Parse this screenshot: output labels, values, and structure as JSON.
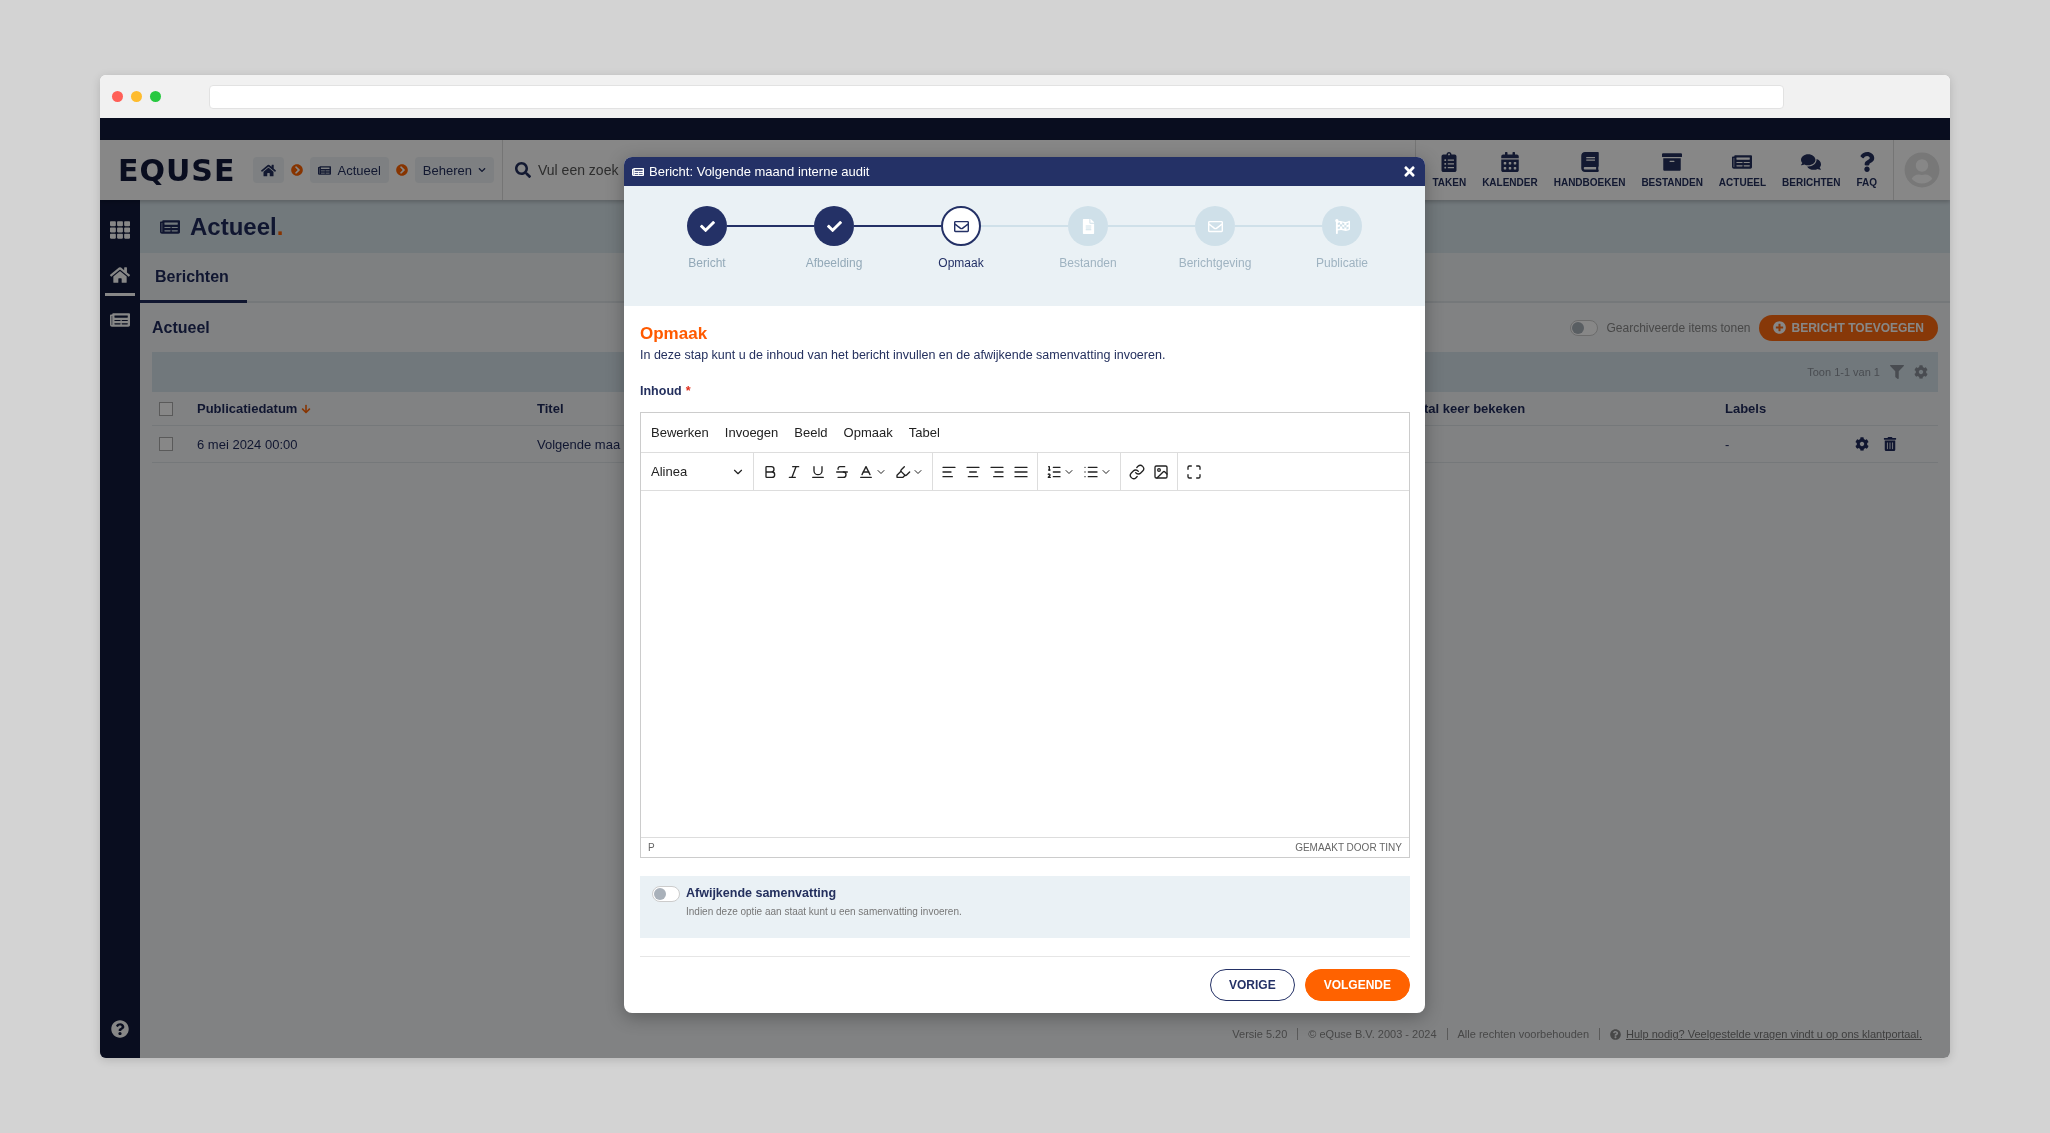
{
  "header": {
    "logo": "EQUSE",
    "breadcrumb": [
      {
        "kind": "home"
      },
      {
        "kind": "link",
        "label": "Actueel"
      },
      {
        "kind": "dropdown",
        "label": "Beheren"
      }
    ],
    "search": {
      "placeholder": "Vul een zoek"
    },
    "nav": [
      {
        "kind": "tasks",
        "label": "TAKEN"
      },
      {
        "kind": "calendar",
        "label": "KALENDER"
      },
      {
        "kind": "book",
        "label": "HANDBOEKEN"
      },
      {
        "kind": "archive",
        "label": "BESTANDEN"
      },
      {
        "kind": "news",
        "label": "ACTUEEL"
      },
      {
        "kind": "chat",
        "label": "BERICHTEN"
      },
      {
        "kind": "faq",
        "label": "FAQ"
      }
    ]
  },
  "sidebar": {
    "items": [
      {
        "kind": "apps",
        "selected": false
      },
      {
        "kind": "home",
        "selected": true
      },
      {
        "kind": "news",
        "selected": false
      }
    ]
  },
  "page": {
    "title": "Actueel",
    "title_suffix": ".",
    "tabs": [
      {
        "label": "Berichten",
        "selected": true
      }
    ],
    "section_title": "Actueel",
    "archive_toggle": {
      "label": "Gearchiveerde items tonen",
      "on": false
    },
    "add_button": "BERICHT TOEVOEGEN",
    "pager": "Toon 1-1 van 1",
    "table": {
      "select_all": {
        "checked": false
      },
      "columns": [
        {
          "label": "Publicatiedatum",
          "sorted": true
        },
        {
          "label": "Titel",
          "sorted": false
        },
        {
          "label": "tal keer bekeken",
          "sorted": false
        },
        {
          "label": "Labels",
          "sorted": false
        }
      ],
      "rows": [
        {
          "checked": false,
          "date": "6 mei 2024 00:00",
          "title": "Volgende maa",
          "labels": "-"
        }
      ]
    }
  },
  "footer": {
    "version": "Versie 5.20",
    "copyright": "© eQuse B.V. 2003 - 2024",
    "rights": "Alle rechten voorbehouden",
    "help_link": "Hulp nodig? Veelgestelde vragen vindt u op ons klantportaal."
  },
  "modal": {
    "title": "Bericht: Volgende maand interne audit",
    "steps": [
      {
        "label": "Bericht",
        "done": true,
        "selected": false,
        "kind": "message"
      },
      {
        "label": "Afbeelding",
        "done": true,
        "selected": false,
        "kind": "image"
      },
      {
        "label": "Opmaak",
        "done": false,
        "selected": true,
        "kind": "layout"
      },
      {
        "label": "Bestanden",
        "done": false,
        "selected": false,
        "kind": "files"
      },
      {
        "label": "Berichtgeving",
        "done": false,
        "selected": false,
        "kind": "notify"
      },
      {
        "label": "Publicatie",
        "done": false,
        "selected": false,
        "kind": "publish"
      }
    ],
    "heading": "Opmaak",
    "description": "In deze stap kunt u de inhoud van het bericht invullen en de afwijkende samenvatting invoeren.",
    "field_label": "Inhoud",
    "required_mark": "*",
    "editor": {
      "menu": [
        "Bewerken",
        "Invoegen",
        "Beeld",
        "Opmaak",
        "Tabel"
      ],
      "block_format": "Alinea",
      "status_path": "P",
      "branding": "GEMAAKT DOOR TINY"
    },
    "summary_toggle": {
      "label": "Afwijkende samenvatting",
      "hint": "Indien deze optie aan staat kunt u een samenvatting invoeren.",
      "on": false
    },
    "buttons": [
      {
        "kind": "secondary",
        "label": "VORIGE"
      },
      {
        "kind": "primary",
        "label": "VOLGENDE"
      }
    ]
  }
}
